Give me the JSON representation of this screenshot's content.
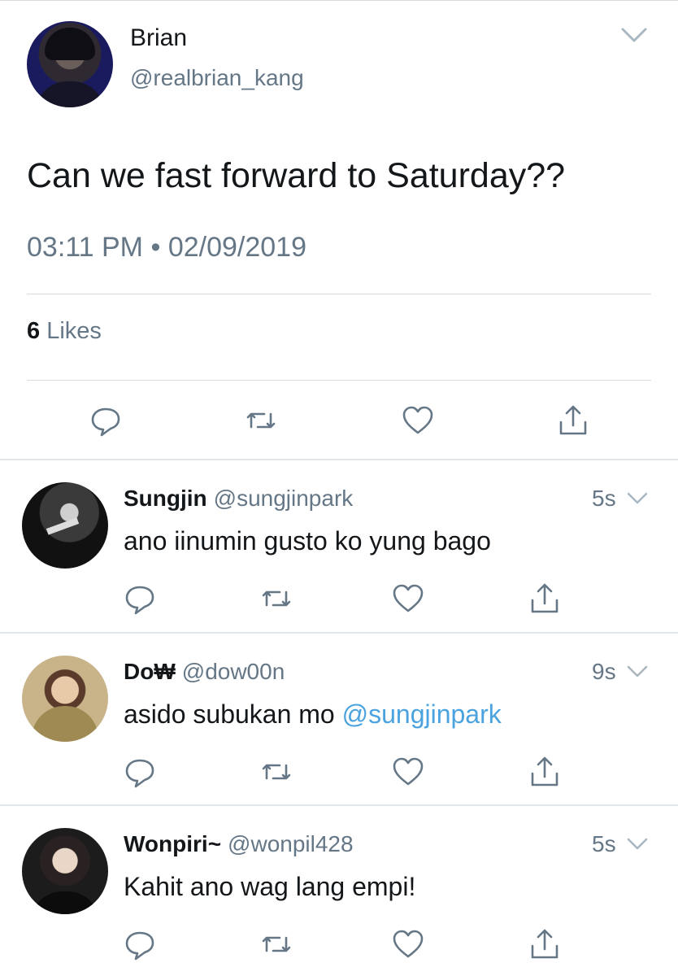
{
  "main_tweet": {
    "name": "Brian",
    "handle": "@realbrian_kang",
    "text": "Can we fast forward to Saturday??",
    "time": "03:11 PM",
    "separator": "•",
    "date": "02/09/2019",
    "likes_count": "6",
    "likes_label": "Likes"
  },
  "replies": [
    {
      "name": "Sungjin",
      "handle": "@sungjinpark",
      "time": "5s",
      "text": "ano iinumin gusto ko yung bago"
    },
    {
      "name": "Do₩",
      "handle": "@dow00n",
      "time": "9s",
      "text_before": "asido subukan mo ",
      "mention": "@sungjinpark"
    },
    {
      "name": "Wonpiri~",
      "handle": "@wonpil428",
      "time": "5s",
      "text": "Kahit ano wag lang empi!"
    }
  ],
  "icons": {
    "reply": "reply-icon",
    "retweet": "retweet-icon",
    "like": "heart-icon",
    "share": "share-icon",
    "menu": "chevron-down-icon"
  },
  "colors": {
    "text": "#14171a",
    "secondary": "#657786",
    "mention": "#4aa3df",
    "divider": "#e1e6ea"
  }
}
